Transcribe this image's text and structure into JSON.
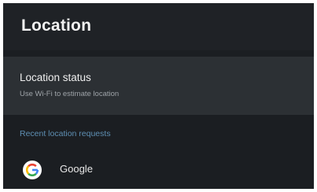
{
  "header": {
    "title": "Location"
  },
  "location_status": {
    "title": "Location status",
    "subtitle": "Use Wi-Fi to estimate location"
  },
  "recent_requests": {
    "section_label": "Recent location requests",
    "apps": [
      {
        "name": "Google",
        "icon": "google-g-icon"
      }
    ]
  },
  "colors": {
    "background": "#1b1e22",
    "row_highlight": "#2c3034",
    "accent": "#5e8fb3",
    "google_red": "#ea4335",
    "google_blue": "#4285f4",
    "google_yellow": "#fbbc05",
    "google_green": "#34a853"
  }
}
